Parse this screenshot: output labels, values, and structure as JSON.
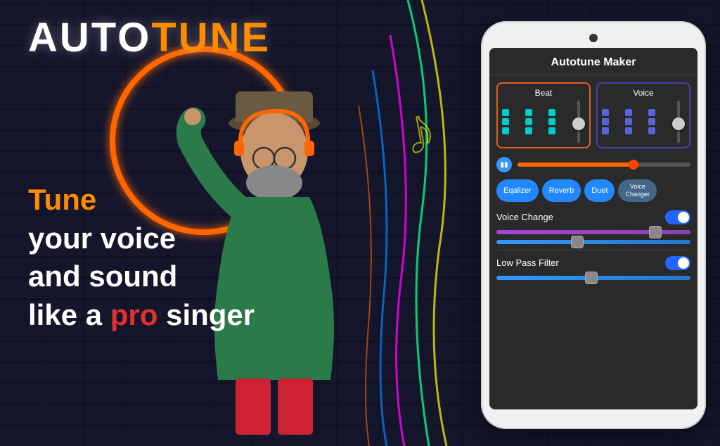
{
  "app": {
    "title": "AUTOTUNE",
    "title_auto": "AUTO",
    "title_tune": "TUNE"
  },
  "tagline": {
    "line1": "Tune",
    "line2": "your voice",
    "line3": "and sound",
    "line4_pre": "like a ",
    "line4_pro": "pro",
    "line4_post": " singer"
  },
  "phone": {
    "header": "Autotune Maker",
    "beat_label": "Beat",
    "voice_label": "Voice",
    "filters": {
      "equalizer": "Eqalizer",
      "reverb": "Reverb",
      "duet": "Duet",
      "voice_changer": "Voice\nChanger"
    },
    "voice_change_label": "Voice Change",
    "low_pass_label": "Low Pass Filter"
  },
  "colors": {
    "orange": "#ff8c00",
    "red": "#e63030",
    "blue": "#2266ff",
    "teal": "#00cccc",
    "purple": "#aa44dd",
    "bg_dark": "#2a2a2a"
  }
}
